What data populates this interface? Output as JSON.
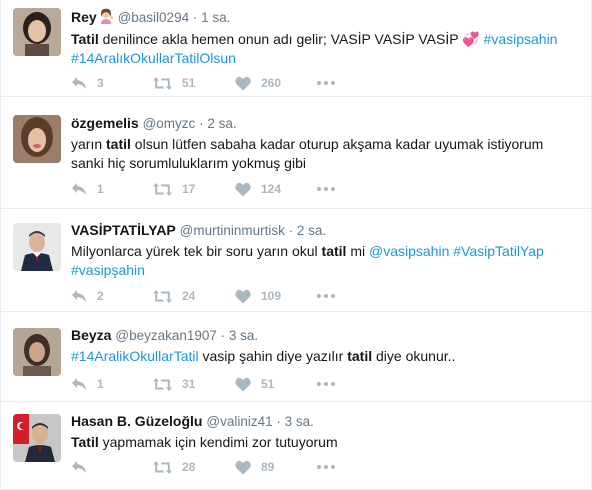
{
  "tweets": [
    {
      "fullname": "Rey",
      "username": "@basil0294",
      "time": "1 sa.",
      "text_parts": [
        {
          "t": "Tatil",
          "b": true
        },
        {
          "t": " denilince akla hemen onun adı gelir; VASİP VASİP VASİP "
        },
        {
          "t": "💞",
          "emoji": true
        },
        {
          "t": " "
        },
        {
          "t": "#vasipsahin",
          "link": true
        },
        {
          "t": " "
        },
        {
          "t": "#14AralıkOkullarTatilOlsun",
          "link": true
        }
      ],
      "replies": "3",
      "retweets": "51",
      "likes": "260",
      "avatar": "woman-dark-hair",
      "name_emoji": "woman-gesturing-icon"
    },
    {
      "fullname": "özgemelis",
      "username": "@omyzc",
      "time": "2 sa.",
      "text_parts": [
        {
          "t": "yarın "
        },
        {
          "t": "tatil",
          "b": true
        },
        {
          "t": " olsun lütfen sabaha kadar oturup akşama kadar uyumak istiyorum sanki hiç sorumluluklarım yokmuş gibi"
        }
      ],
      "replies": "1",
      "retweets": "17",
      "likes": "124",
      "avatar": "woman-brown-hair"
    },
    {
      "fullname": "VASİPTATİLYAP",
      "username": "@murtininmurtisk",
      "time": "2 sa.",
      "text_parts": [
        {
          "t": "Milyonlarca yürek tek bir soru yarın okul "
        },
        {
          "t": "tatil",
          "b": true
        },
        {
          "t": " mi "
        },
        {
          "t": "@vasipsahin",
          "link": true
        },
        {
          "t": " "
        },
        {
          "t": "#VasipTatilYap",
          "link": true
        },
        {
          "t": " "
        },
        {
          "t": "#vasipşahin",
          "link": true
        }
      ],
      "replies": "2",
      "retweets": "24",
      "likes": "109",
      "avatar": "man-suit"
    },
    {
      "fullname": "Beyza",
      "username": "@beyzakan1907",
      "time": "3 sa.",
      "text_parts": [
        {
          "t": "#14AralikOkullarTatil",
          "link": true
        },
        {
          "t": " vasip şahin diye yazılır "
        },
        {
          "t": "tatil",
          "b": true
        },
        {
          "t": " diye okunur.."
        }
      ],
      "replies": "1",
      "retweets": "31",
      "likes": "51",
      "avatar": "person-blurred"
    },
    {
      "fullname": "Hasan B. Güzeloğlu",
      "username": "@valiniz41",
      "time": "3 sa.",
      "text_parts": [
        {
          "t": "Tatil",
          "b": true
        },
        {
          "t": " yapmamak için kendimi zor tutuyorum"
        }
      ],
      "replies": "",
      "retweets": "28",
      "likes": "89",
      "avatar": "man-flag"
    }
  ],
  "colors": {
    "link": "#1b95e0",
    "muted": "#657786",
    "icon": "#aab8c2",
    "border": "#e6ecf0"
  }
}
